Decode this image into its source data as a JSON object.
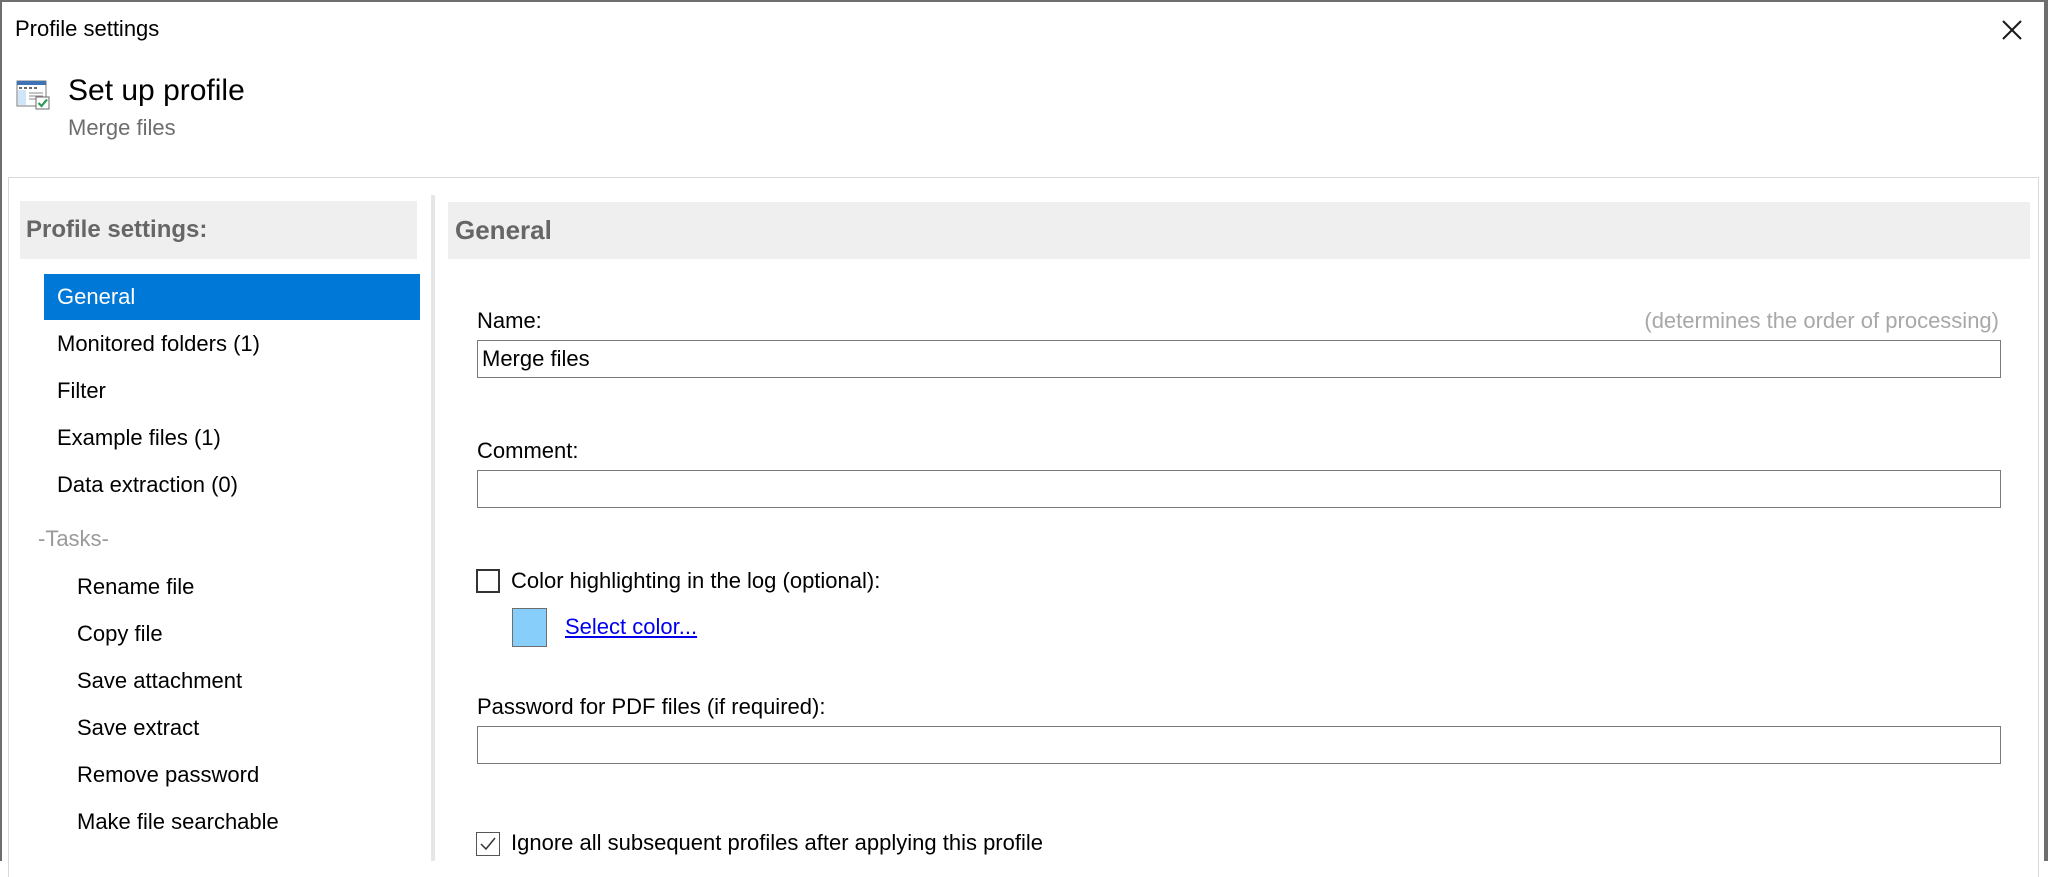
{
  "window": {
    "title": "Profile settings",
    "close_icon": "close-x-icon"
  },
  "header": {
    "icon": "profile-window-check-icon",
    "title": "Set up profile",
    "subtitle": "Merge files"
  },
  "sidebar": {
    "heading": "Profile settings:",
    "items": [
      {
        "label": "General",
        "selected": true
      },
      {
        "label": "Monitored folders (1)",
        "selected": false
      },
      {
        "label": "Filter",
        "selected": false
      },
      {
        "label": "Example files (1)",
        "selected": false
      },
      {
        "label": "Data extraction (0)",
        "selected": false
      }
    ],
    "tasks_separator": "-Tasks-",
    "tasks": [
      {
        "label": "Rename file"
      },
      {
        "label": "Copy file"
      },
      {
        "label": "Save attachment"
      },
      {
        "label": "Save extract"
      },
      {
        "label": "Remove password"
      },
      {
        "label": "Make file searchable"
      }
    ],
    "selected_color": "#0078d7"
  },
  "main": {
    "heading": "General",
    "name": {
      "label": "Name:",
      "hint": "(determines the order of processing)",
      "value": "Merge files"
    },
    "comment": {
      "label": "Comment:",
      "value": ""
    },
    "color_highlight": {
      "label": "Color highlighting in the log (optional):",
      "checked": false,
      "swatch_color": "#87cefa",
      "select_label": "Select color..."
    },
    "password": {
      "label": "Password for PDF files (if required):",
      "value": ""
    },
    "ignore_subsequent": {
      "label": "Ignore all subsequent profiles after applying this profile",
      "checked": true
    }
  }
}
